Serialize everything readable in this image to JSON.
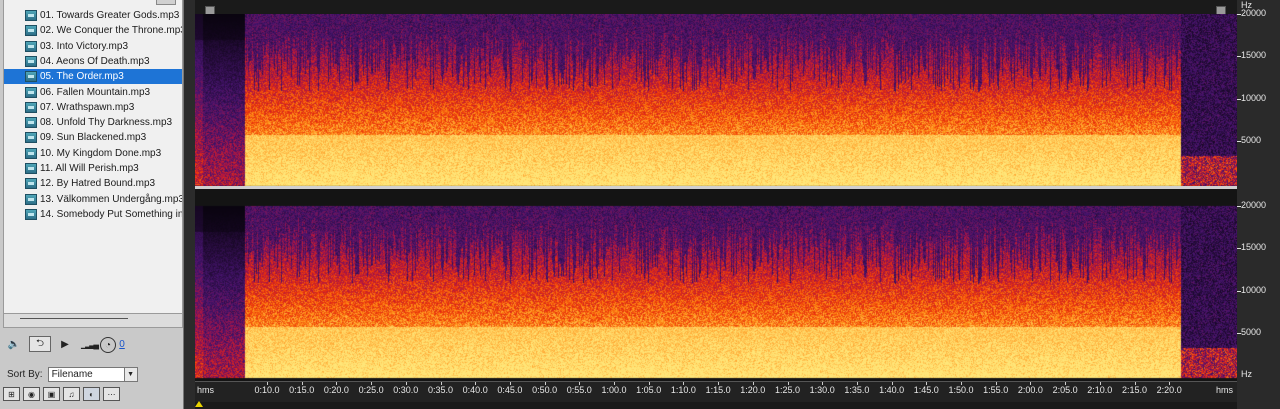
{
  "files": [
    "01. Towards Greater Gods.mp3",
    "02. We Conquer the Throne.mp3",
    "03. Into Victory.mp3",
    "04. Aeons Of Death.mp3",
    "05. The Order.mp3",
    "06. Fallen Mountain.mp3",
    "07. Wrathspawn.mp3",
    "08. Unfold Thy Darkness.mp3",
    "09. Sun Blackened.mp3",
    "10. My Kingdom Done.mp3",
    "11. All Will Perish.mp3",
    "12. By Hatred Bound.mp3",
    "13. Välkommen Undergång.mp3",
    "14. Somebody Put Something in"
  ],
  "selected_index": 4,
  "transport": {
    "volume_value": "0"
  },
  "sort": {
    "label": "Sort By:",
    "value": "Filename"
  },
  "spectral": {
    "freq_unit": "Hz",
    "freq_labels": [
      "20000",
      "15000",
      "10000",
      "5000"
    ],
    "time_unit": "hms",
    "time_labels": [
      "0:10.0",
      "0:15.0",
      "0:20.0",
      "0:25.0",
      "0:30.0",
      "0:35.0",
      "0:40.0",
      "0:45.0",
      "0:50.0",
      "0:55.0",
      "1:00.0",
      "1:05.0",
      "1:10.0",
      "1:15.0",
      "1:20.0",
      "1:25.0",
      "1:30.0",
      "1:35.0",
      "1:40.0",
      "1:45.0",
      "1:50.0",
      "1:55.0",
      "2:00.0",
      "2:05.0",
      "2:10.0",
      "2:15.0",
      "2:20.0"
    ],
    "colors": {
      "low": "#ffe27a",
      "mid": "#ff5a10",
      "high": "#7a1a8a",
      "bg": "#0a0410"
    }
  }
}
